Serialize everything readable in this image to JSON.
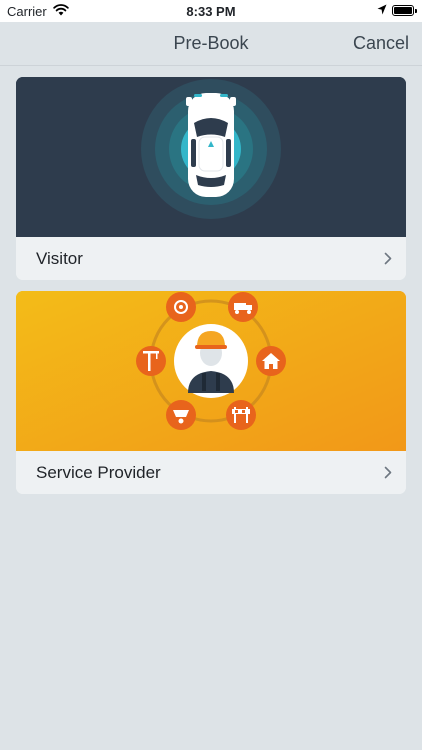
{
  "status_bar": {
    "carrier": "Carrier",
    "time": "8:33 PM"
  },
  "nav": {
    "title": "Pre-Book",
    "cancel_label": "Cancel"
  },
  "cards": [
    {
      "label": "Visitor",
      "illustration": "car-top-view"
    },
    {
      "label": "Service Provider",
      "illustration": "worker-with-service-icons"
    }
  ],
  "colors": {
    "background": "#dde3e7",
    "visitor_art": "#2e3c4d",
    "service_art": "#f4a71b",
    "accent_teal": "#33b6c9",
    "accent_orange": "#e8641c"
  }
}
